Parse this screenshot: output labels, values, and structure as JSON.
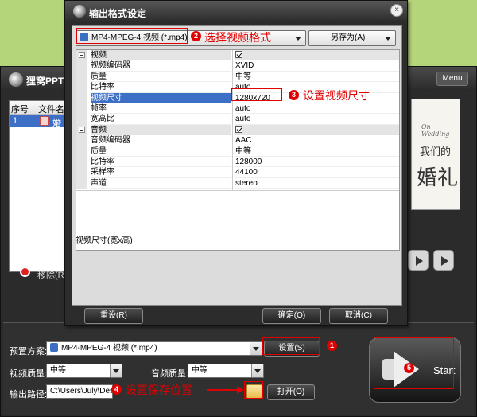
{
  "app": {
    "name": "狸窝PPT!",
    "menu_label": "Menu",
    "file_list": {
      "headers": [
        "序号",
        "文件名"
      ],
      "rows": [
        {
          "index": "1",
          "name": "婚礼"
        }
      ]
    },
    "remove_label": "移除(R)",
    "preview": {
      "line1": "On Wedding",
      "line2": "我们的",
      "line3": "婚礼"
    },
    "bottom": {
      "preset_label": "预置方案:",
      "preset_value": "MP4-MPEG-4 视频 (*.mp4)",
      "settings_button": "设置(S)",
      "video_quality_label": "视频质量:",
      "video_quality_value": "中等",
      "audio_quality_label": "音频质量:",
      "audio_quality_value": "中等",
      "output_path_label": "输出路径:",
      "output_path_value": "C:\\Users\\July\\Deskto",
      "open_button": "打开(O)",
      "start_label": "Start"
    }
  },
  "dialog": {
    "title": "输出格式设定",
    "close_label": "×",
    "format_value": "MP4-MPEG-4 视频 (*.mp4)",
    "save_as_label": "另存为(A)",
    "rows": [
      {
        "name": "视频",
        "value": "",
        "type": "category",
        "checked": true
      },
      {
        "name": "视频编码器",
        "value": "XVID"
      },
      {
        "name": "质量",
        "value": "中等"
      },
      {
        "name": "比特率",
        "value": "auto"
      },
      {
        "name": "视频尺寸",
        "value": "1280x720",
        "selected": true
      },
      {
        "name": "帧率",
        "value": "auto"
      },
      {
        "name": "宽高比",
        "value": "auto"
      },
      {
        "name": "音频",
        "value": "",
        "type": "category",
        "checked": true
      },
      {
        "name": "音频编码器",
        "value": "AAC"
      },
      {
        "name": "质量",
        "value": "中等"
      },
      {
        "name": "比特率",
        "value": "128000"
      },
      {
        "name": "采样率",
        "value": "44100"
      },
      {
        "name": "声道",
        "value": "stereo"
      }
    ],
    "description": "视频尺寸(宽x高)",
    "reset_button": "重设(R)",
    "ok_button": "确定(O)",
    "cancel_button": "取消(C)"
  },
  "annotations": {
    "step1_num": "1",
    "step2_num": "2",
    "step2_text": "选择视频格式",
    "step3_num": "3",
    "step3_text": "设置视频尺寸",
    "step4_num": "4",
    "step4_text": "设置保存位置",
    "step5_num": "5"
  },
  "colors": {
    "annotation_red": "#e00000",
    "selection_blue": "#3d6fc7",
    "background_green": "#b5d57a"
  }
}
